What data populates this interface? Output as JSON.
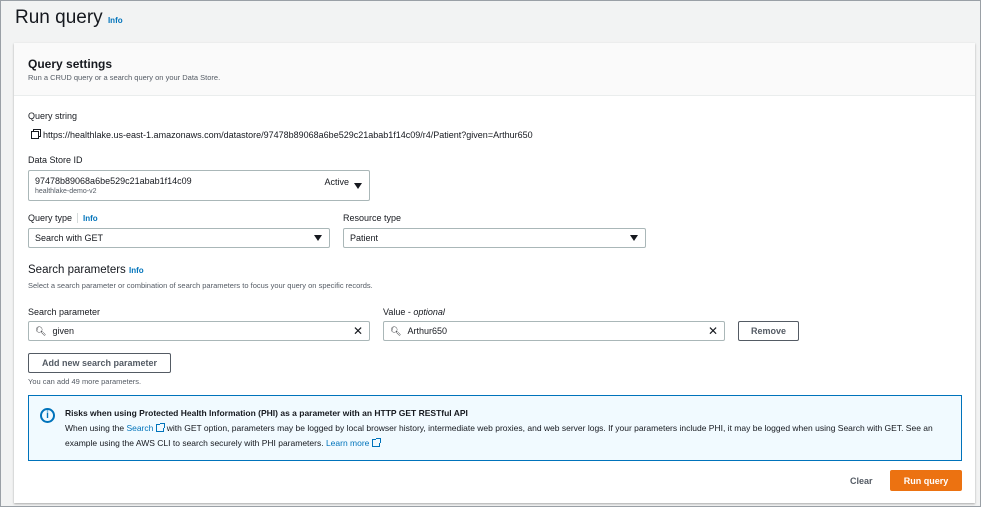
{
  "header": {
    "title": "Run query",
    "info": "Info"
  },
  "card": {
    "title": "Query settings",
    "description": "Run a CRUD query or a search query on your Data Store."
  },
  "query_string": {
    "label": "Query string",
    "value": "https://healthlake.us-east-1.amazonaws.com/datastore/97478b89068a6be529c21abab1f14c09/r4/Patient?given=Arthur650"
  },
  "data_store": {
    "label": "Data Store ID",
    "id": "97478b89068a6be529c21abab1f14c09",
    "name": "healthlake-demo-v2",
    "status": "Active"
  },
  "query_type": {
    "label": "Query type",
    "info": "Info",
    "value": "Search with GET"
  },
  "resource_type": {
    "label": "Resource type",
    "value": "Patient"
  },
  "search_params": {
    "title": "Search parameters",
    "info": "Info",
    "description": "Select a search parameter or combination of search parameters to focus your query on specific records.",
    "param_label": "Search parameter",
    "param_value": "given",
    "value_label": "Value",
    "value_optional": "optional",
    "value_value": "Arthur650",
    "remove": "Remove",
    "add": "Add new search parameter",
    "hint": "You can add 49 more parameters."
  },
  "alert": {
    "title": "Risks when using Protected Health Information (PHI) as a parameter with an HTTP GET RESTful API",
    "text1": "When using the ",
    "link1": "Search",
    "text2": " with GET option, parameters may be logged by local browser history, intermediate web proxies, and web server logs. If your parameters include PHI, it may be logged when using Search with GET. See an example using the AWS CLI to search securely with PHI parameters. ",
    "link2": "Learn more"
  },
  "footer": {
    "clear": "Clear",
    "run": "Run query"
  },
  "colors": {
    "accent": "#ec7211",
    "link": "#0073bb",
    "alert_bg": "#f1faff"
  }
}
